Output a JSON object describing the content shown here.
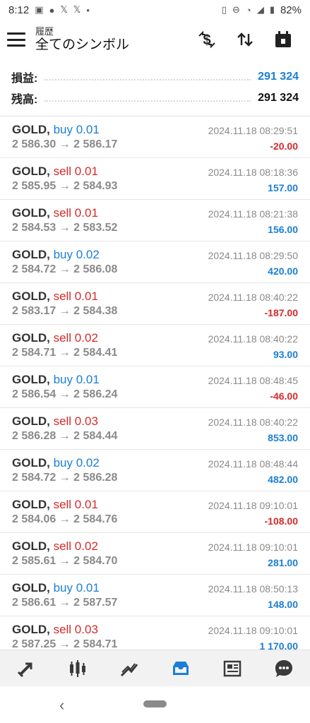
{
  "status": {
    "time": "8:12",
    "battery": "82%",
    "left_icons": [
      "image-icon",
      "line-icon",
      "x-icon",
      "x-icon",
      "dot-icon"
    ],
    "right_icons": [
      "vibrate-icon",
      "dnd-icon",
      "wifi-icon",
      "signal-icon",
      "battery-icon"
    ]
  },
  "header": {
    "subtitle": "履歴",
    "title": "全てのシンボル",
    "menu_icon": "hamburger-icon",
    "actions": [
      "currency-exchange-icon",
      "sort-icon",
      "calendar-icon"
    ]
  },
  "summary": {
    "profit_label": "損益:",
    "profit_value": "291 324",
    "balance_label": "残高:",
    "balance_value": "291 324",
    "colors": {
      "profit": "#1a7fd6",
      "balance": "#111111"
    }
  },
  "colors": {
    "buy": "#1a7fd6",
    "sell": "#d62a2a",
    "positive": "#1a7fd6",
    "negative": "#d62a2a"
  },
  "trades": [
    {
      "symbol": "GOLD,",
      "side": "buy",
      "volume": "buy 0.01",
      "prices": "2 586.30 → 2 586.17",
      "time": "2024.11.18 08:29:51",
      "pl": "-20.00",
      "neg": true
    },
    {
      "symbol": "GOLD,",
      "side": "sell",
      "volume": "sell 0.01",
      "prices": "2 585.95 → 2 584.93",
      "time": "2024.11.18 08:18:36",
      "pl": "157.00",
      "neg": false
    },
    {
      "symbol": "GOLD,",
      "side": "sell",
      "volume": "sell 0.01",
      "prices": "2 584.53 → 2 583.52",
      "time": "2024.11.18 08:21:38",
      "pl": "156.00",
      "neg": false
    },
    {
      "symbol": "GOLD,",
      "side": "buy",
      "volume": "buy 0.02",
      "prices": "2 584.72 → 2 586.08",
      "time": "2024.11.18 08:29:50",
      "pl": "420.00",
      "neg": false
    },
    {
      "symbol": "GOLD,",
      "side": "sell",
      "volume": "sell 0.01",
      "prices": "2 583.17 → 2 584.38",
      "time": "2024.11.18 08:40:22",
      "pl": "-187.00",
      "neg": true
    },
    {
      "symbol": "GOLD,",
      "side": "sell",
      "volume": "sell 0.02",
      "prices": "2 584.71 → 2 584.41",
      "time": "2024.11.18 08:40:22",
      "pl": "93.00",
      "neg": false
    },
    {
      "symbol": "GOLD,",
      "side": "buy",
      "volume": "buy 0.01",
      "prices": "2 586.54 → 2 586.24",
      "time": "2024.11.18 08:48:45",
      "pl": "-46.00",
      "neg": true
    },
    {
      "symbol": "GOLD,",
      "side": "sell",
      "volume": "sell 0.03",
      "prices": "2 586.28 → 2 584.44",
      "time": "2024.11.18 08:40:22",
      "pl": "853.00",
      "neg": false
    },
    {
      "symbol": "GOLD,",
      "side": "buy",
      "volume": "buy 0.02",
      "prices": "2 584.72 → 2 586.28",
      "time": "2024.11.18 08:48:44",
      "pl": "482.00",
      "neg": false
    },
    {
      "symbol": "GOLD,",
      "side": "sell",
      "volume": "sell 0.01",
      "prices": "2 584.06 → 2 584.76",
      "time": "2024.11.18 09:10:01",
      "pl": "-108.00",
      "neg": true
    },
    {
      "symbol": "GOLD,",
      "side": "sell",
      "volume": "sell 0.02",
      "prices": "2 585.61 → 2 584.70",
      "time": "2024.11.18 09:10:01",
      "pl": "281.00",
      "neg": false
    },
    {
      "symbol": "GOLD,",
      "side": "buy",
      "volume": "buy 0.01",
      "prices": "2 586.61 → 2 587.57",
      "time": "2024.11.18 08:50:13",
      "pl": "148.00",
      "neg": false
    },
    {
      "symbol": "GOLD,",
      "side": "sell",
      "volume": "sell 0.03",
      "prices": "2 587.25 → 2 584.71",
      "time": "2024.11.18 09:10:01",
      "pl": "1 170.00",
      "neg": false
    }
  ],
  "bottom_nav": [
    {
      "icon": "quotes-icon",
      "active": false
    },
    {
      "icon": "chart-icon",
      "active": false
    },
    {
      "icon": "trade-icon",
      "active": false
    },
    {
      "icon": "history-icon",
      "active": true
    },
    {
      "icon": "news-icon",
      "active": false
    },
    {
      "icon": "chat-icon",
      "active": false
    }
  ],
  "system_nav": {
    "back_icon": "back-icon",
    "home_icon": "home-pill-icon"
  }
}
